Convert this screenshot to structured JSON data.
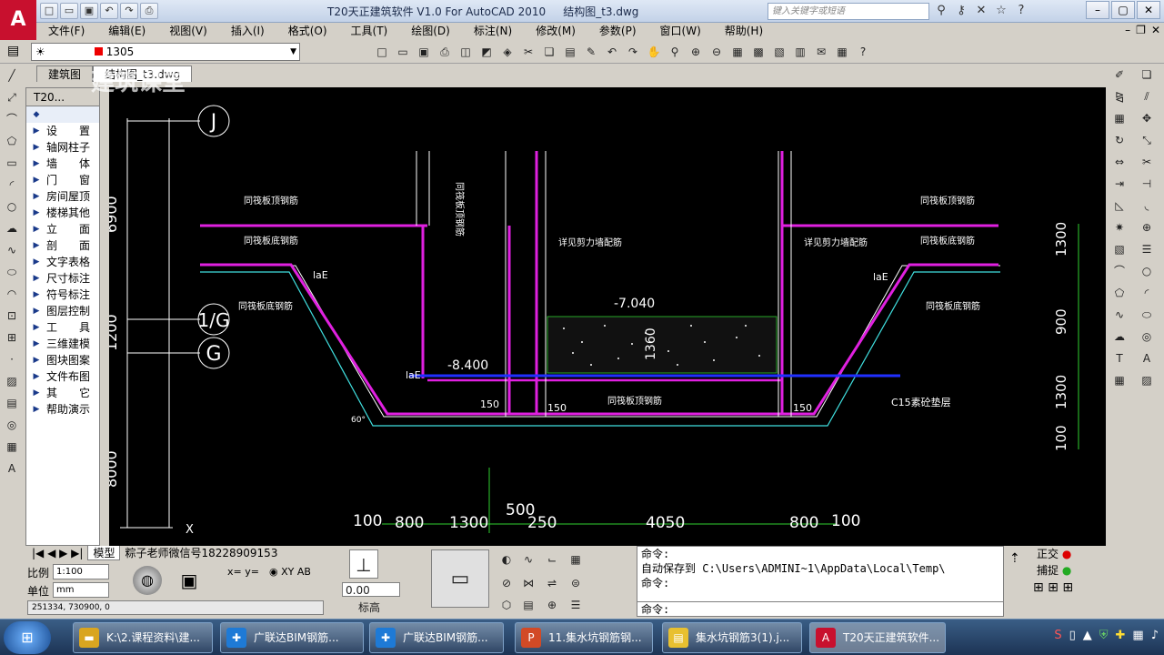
{
  "app": {
    "logo": "A",
    "title": "T20天正建筑软件 V1.0 For AutoCAD 2010",
    "file": "结构图_t3.dwg",
    "search_placeholder": "键入关键字或短语",
    "watermark": "建筑课堂"
  },
  "menu": [
    "文件(F)",
    "编辑(E)",
    "视图(V)",
    "插入(I)",
    "格式(O)",
    "工具(T)",
    "绘图(D)",
    "标注(N)",
    "修改(M)",
    "参数(P)",
    "窗口(W)",
    "帮助(H)"
  ],
  "layer": {
    "current": "1305"
  },
  "doc_tabs": [
    "建筑图",
    "结构图_t3.dwg"
  ],
  "t20": {
    "header": "T20...",
    "items": [
      "设　　置",
      "轴网柱子",
      "墙　　体",
      "门　　窗",
      "房间屋顶",
      "楼梯其他",
      "立　　面",
      "剖　　面",
      "文字表格",
      "尺寸标注",
      "符号标注",
      "图层控制",
      "工　　具",
      "三维建模",
      "图块图案",
      "文件布图",
      "其　　它",
      "帮助演示"
    ]
  },
  "drawing": {
    "axis_labels": [
      "J",
      "1/G",
      "G"
    ],
    "axis_x": "X",
    "left_dims": [
      "6900",
      "1200",
      "8000"
    ],
    "right_dims": [
      "1300",
      "900",
      "1300",
      "100"
    ],
    "bottom_dims": [
      "100",
      "800",
      "1300",
      "500",
      "250",
      "4050",
      "800",
      "100"
    ],
    "elevations": [
      "-7.040",
      "-8.400"
    ],
    "depth": "1360",
    "notes": {
      "top_left_1": "同筏板顶钢筋",
      "top_left_2": "同筏板底钢筋",
      "slope_left": "同筏板底钢筋",
      "top_right_1": "同筏板顶钢筋",
      "top_right_2": "同筏板底钢筋",
      "slope_right": "同筏板底钢筋",
      "wall_left": "详见剪力墙配筋",
      "wall_right": "详见剪力墙配筋",
      "bottom": "同筏板顶钢筋",
      "vertical": "同筏板顶钢筋",
      "cushion": "C15素砼垫层",
      "lae": "laE",
      "n150": "150",
      "angle": "60°"
    },
    "colors": {
      "magenta": "#e020e0",
      "white": "#ffffff",
      "cyan": "#40e0e0",
      "blue": "#2030ff",
      "green": "#30d030"
    }
  },
  "layout_tabs": [
    "模型",
    "粽子老师微信号18228909153"
  ],
  "scale": {
    "label": "比例",
    "value": "1:100",
    "unit_label": "单位",
    "unit": "mm"
  },
  "elev_field": {
    "value": "0.00",
    "label": "标高"
  },
  "coords": "251334, 730900, 0",
  "command": {
    "lines": [
      "命令:",
      "自动保存到 C:\\Users\\ADMINI~1\\AppData\\Local\\Temp\\",
      "命令:"
    ],
    "prompt": "命令:"
  },
  "osnap": {
    "ortho": "正交",
    "snap": "捕捉"
  },
  "taskbar": [
    {
      "label": "K:\\2.课程资料\\建...",
      "color": "#d9a520"
    },
    {
      "label": "广联达BIM钢筋...",
      "color": "#1e7ad6"
    },
    {
      "label": "广联达BIM钢筋...",
      "color": "#1e7ad6"
    },
    {
      "label": "11.集水坑钢筋钢...",
      "color": "#d24a26"
    },
    {
      "label": "集水坑钢筋3(1).j...",
      "color": "#e8c030"
    },
    {
      "label": "T20天正建筑软件...",
      "color": "#c8102e"
    }
  ]
}
